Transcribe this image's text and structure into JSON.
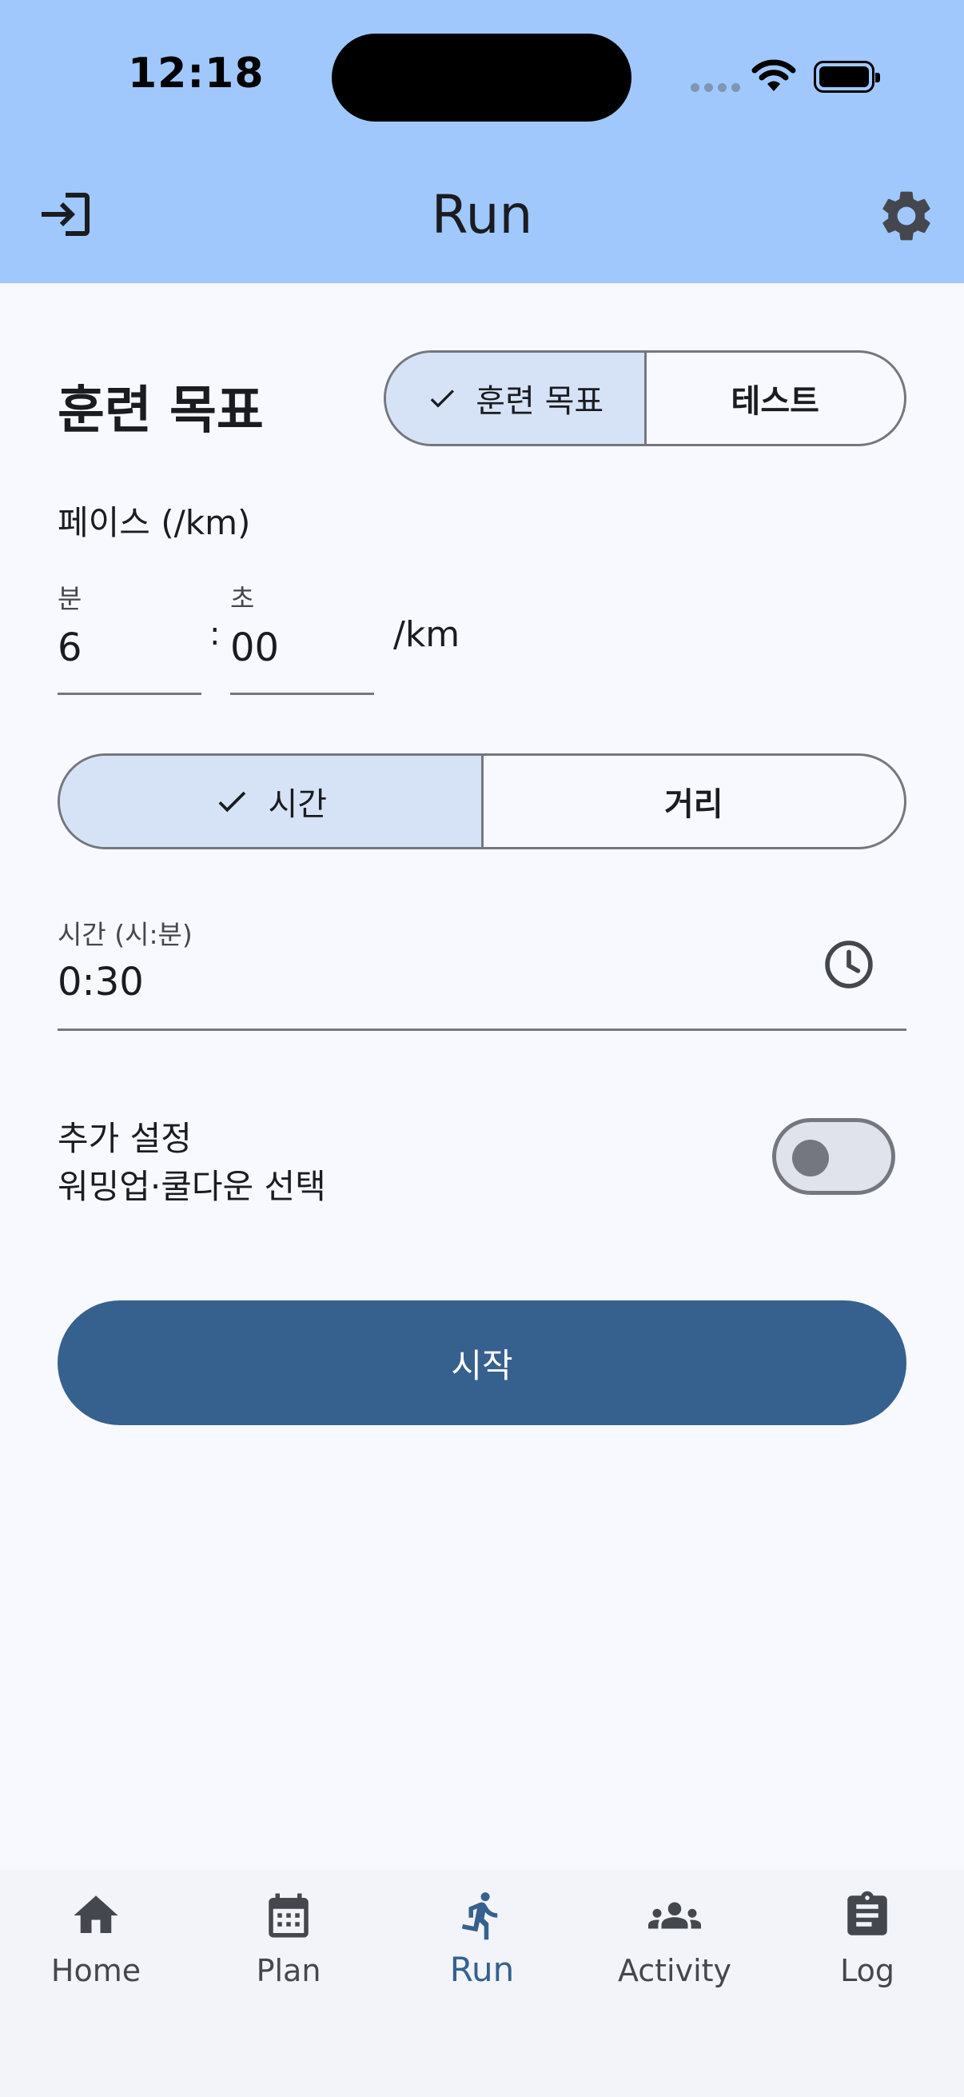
{
  "status_bar": {
    "time": "12:18"
  },
  "header": {
    "title": "Run"
  },
  "section": {
    "title": "훈련 목표",
    "mode_options": [
      {
        "label": "훈련 목표",
        "selected": true
      },
      {
        "label": "테스트",
        "selected": false
      }
    ]
  },
  "pace": {
    "label": "페이스 (/km)",
    "minutes_label": "분",
    "minutes_value": "6",
    "separator": ":",
    "seconds_label": "초",
    "seconds_value": "00",
    "unit": "/km"
  },
  "goal_type": {
    "options": [
      {
        "label": "시간",
        "selected": true
      },
      {
        "label": "거리",
        "selected": false
      }
    ]
  },
  "duration": {
    "label": "시간 (시:분)",
    "value": "0:30"
  },
  "extra": {
    "title": "추가 설정",
    "subtitle": "워밍업·쿨다운 선택",
    "enabled": false
  },
  "start_button": {
    "label": "시작"
  },
  "bottom_nav": {
    "items": [
      {
        "label": "Home",
        "icon": "home-icon",
        "active": false
      },
      {
        "label": "Plan",
        "icon": "calendar-icon",
        "active": false
      },
      {
        "label": "Run",
        "icon": "running-icon",
        "active": true
      },
      {
        "label": "Activity",
        "icon": "group-icon",
        "active": false
      },
      {
        "label": "Log",
        "icon": "clipboard-icon",
        "active": false
      }
    ]
  },
  "colors": {
    "header_bg": "#a0c8fd",
    "page_bg": "#f7f9fe",
    "primary": "#36618e",
    "selected_segment": "#d6e3f7",
    "outline": "#74777f"
  }
}
